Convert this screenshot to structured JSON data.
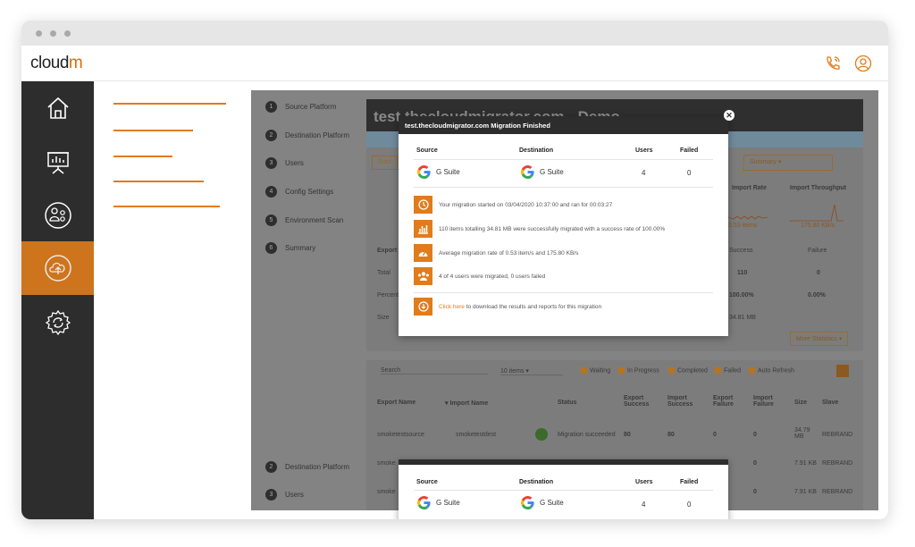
{
  "app": {
    "logo_text": "cloud",
    "logo_m": "m"
  },
  "steps_top": [
    {
      "num": "1",
      "label": "Source Platform"
    },
    {
      "num": "2",
      "label": "Destination Platform"
    },
    {
      "num": "3",
      "label": "Users"
    },
    {
      "num": "4",
      "label": "Config Settings"
    },
    {
      "num": "5",
      "label": "Environment Scan"
    },
    {
      "num": "6",
      "label": "Summary"
    }
  ],
  "steps_bottom": [
    {
      "num": "2",
      "label": "Destination Platform"
    },
    {
      "num": "3",
      "label": "Users"
    }
  ],
  "panel": {
    "title": "test.thecloudmigrator.com - Demo",
    "start_button": "Start",
    "summary_select": "Summary",
    "export_label": "Export",
    "total_label": "Total",
    "percent_label": "Percent",
    "size_label": "Size",
    "import_rate": "Import Rate",
    "import_throughput": "Import Throughput",
    "rate_value": "0.53 items",
    "throughput_value": "175.80 KB/s",
    "success": "Success",
    "failure": "Failure",
    "success_total": "110",
    "failure_total": "0",
    "success_pct": "100.00%",
    "failure_pct": "0.00%",
    "size_value": "34.81 MB",
    "more_stats": "More Statistics"
  },
  "filters": {
    "search_placeholder": "Search",
    "items_select": "10 items",
    "waiting": "Waiting",
    "in_progress": "In Progress",
    "completed": "Completed",
    "failed": "Failed",
    "auto_refresh": "Auto Refresh"
  },
  "table": {
    "headers": [
      "Export Name",
      "Import Name",
      "Status",
      "Export Success",
      "Import Success",
      "Export Failure",
      "Import Failure",
      "Size",
      "Slave"
    ],
    "rows": [
      {
        "export": "smoketestsource",
        "import": "smoketestdest",
        "status": "Migration succeeded",
        "es": "80",
        "is": "80",
        "ef": "0",
        "if": "0",
        "size": "34.79 MB",
        "slave": "REBRAND"
      },
      {
        "export": "smoke",
        "import": "",
        "status": "",
        "es": "",
        "is": "",
        "ef": "",
        "if": "0",
        "size": "7.91 KB",
        "slave": "REBRAND"
      },
      {
        "export": "smoke",
        "import": "",
        "status": "",
        "es": "",
        "is": "",
        "ef": "",
        "if": "0",
        "size": "7.91 KB",
        "slave": "REBRAND"
      }
    ]
  },
  "modal": {
    "title": "test.thecloudmigrator.com Migration Finished",
    "col_source": "Source",
    "col_destination": "Destination",
    "col_users": "Users",
    "col_failed": "Failed",
    "source": "G Suite",
    "destination": "G Suite",
    "users": "4",
    "failed": "0",
    "stats": [
      {
        "icon": "clock-icon",
        "text": "Your migration started on 03/04/2020 10:37:00 and ran for 00:03:27"
      },
      {
        "icon": "bar-chart-icon",
        "text": "110 items totalling 34.81 MB were successfully migrated with a success rate of 100.00%"
      },
      {
        "icon": "speedometer-icon",
        "text": "Average migration rate of 0.53 item/s and 175.80 KB/s"
      },
      {
        "icon": "users-icon",
        "text": "4 of 4 users were migrated, 0 users failed"
      }
    ],
    "download_link": "Click here",
    "download_text": " to download the results and reports for this migration"
  },
  "modal2": {
    "col_source": "Source",
    "col_destination": "Destination",
    "col_users": "Users",
    "col_failed": "Failed",
    "source": "G Suite",
    "destination": "G Suite",
    "users": "4",
    "failed": "0"
  },
  "colors": {
    "accent": "#e07c1c",
    "nav_bg": "#2d2d2d",
    "brand_m": "#e06b00"
  }
}
